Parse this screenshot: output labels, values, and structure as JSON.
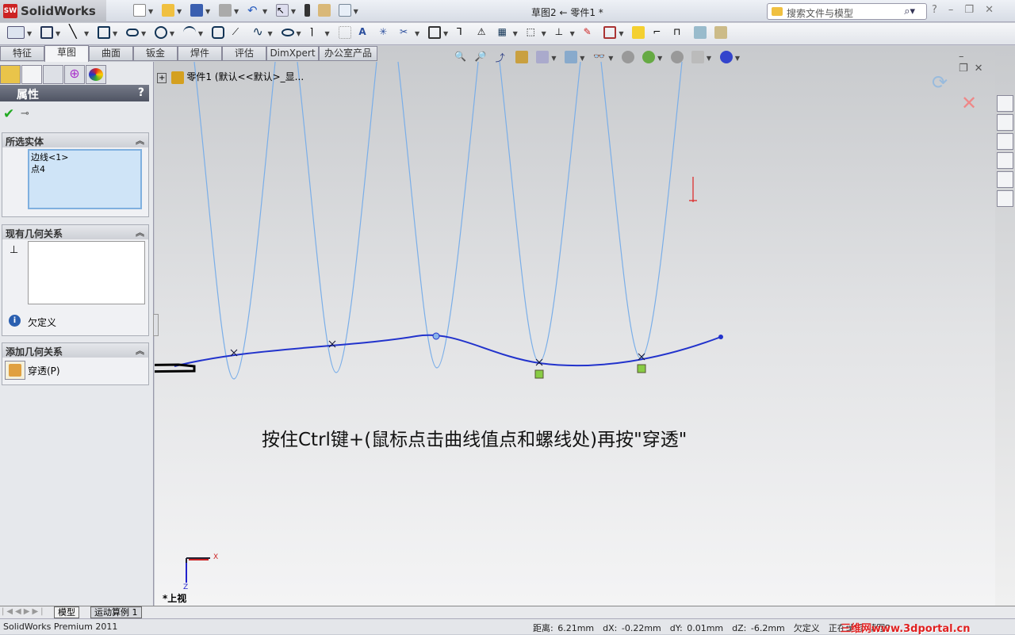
{
  "app": {
    "logo": "SolidWorks",
    "doc_title": "草图2 ← 零件1 *"
  },
  "search": {
    "placeholder": "搜索文件与模型"
  },
  "window_controls": [
    "?",
    "–",
    "❐",
    "✕"
  ],
  "command_tabs": [
    "特征",
    "草图",
    "曲面",
    "钣金",
    "焊件",
    "评估",
    "DimXpert",
    "办公室产品"
  ],
  "active_tab": "草图",
  "tree": {
    "root": "零件1 (默认<<默认>_显..."
  },
  "property": {
    "title": "属性",
    "help": "?"
  },
  "groups": {
    "selected": {
      "title": "所选实体",
      "items": [
        "边线<1>",
        "点4"
      ]
    },
    "existing": {
      "title": "现有几何关系",
      "status": "欠定义"
    },
    "add": {
      "title": "添加几何关系",
      "button": "穿透(P)"
    }
  },
  "annotation": "按住Ctrl键+(鼠标点击曲线值点和螺线处)再按\"穿透\"",
  "view_label": "*上视",
  "triad": {
    "x": "X",
    "z": "Z"
  },
  "bottom_tabs": [
    "模型",
    "运动算例 1"
  ],
  "status": {
    "product": "SolidWorks Premium 2011",
    "distance": "距离: 6.21mm",
    "dx": "dX: -0.22mm",
    "dy": "dY: 0.01mm",
    "dz": "dZ: -6.2mm",
    "state": "欠定义",
    "editing": "正在编辑 草图2",
    "watermark": "三维网www.3dportal.cn"
  },
  "colors": {
    "helix": "#7aaee8",
    "spline": "#2233cc",
    "accent": "#4f5463"
  }
}
